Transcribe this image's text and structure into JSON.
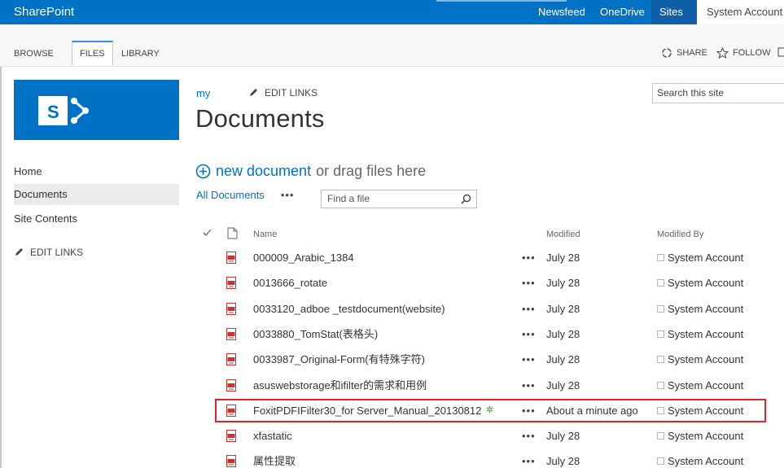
{
  "suitebar": {
    "brand": "SharePoint",
    "links": [
      "Newsfeed",
      "OneDrive",
      "Sites"
    ],
    "account": "System Account"
  },
  "ribbon": {
    "tabs": [
      "BROWSE",
      "FILES",
      "LIBRARY"
    ],
    "active_tab": "FILES",
    "share": "SHARE",
    "follow": "FOLLOW"
  },
  "nav": {
    "items": [
      "Home",
      "Documents",
      "Site Contents"
    ],
    "selected": "Documents",
    "edit_links": "EDIT LINKS"
  },
  "header": {
    "breadcrumb": "my",
    "edit_links": "EDIT LINKS",
    "title": "Documents",
    "search_placeholder": "Search this site"
  },
  "library": {
    "new_document": "new document",
    "drag_text": "or drag files here",
    "view": "All Documents",
    "more": "•••",
    "find_placeholder": "Find a file",
    "columns": {
      "name": "Name",
      "modified": "Modified",
      "modified_by": "Modified By"
    },
    "files": [
      {
        "name": "000009_Arabic_1384",
        "modified": "July 28",
        "modified_by": "System Account"
      },
      {
        "name": "0013666_rotate",
        "modified": "July 28",
        "modified_by": "System Account"
      },
      {
        "name": "0033120_adboe _testdocument(website)",
        "modified": "July 28",
        "modified_by": "System Account"
      },
      {
        "name": "0033880_TomStat(表格头)",
        "modified": "July 28",
        "modified_by": "System Account"
      },
      {
        "name": "0033987_Original-Form(有特殊字符)",
        "modified": "July 28",
        "modified_by": "System Account"
      },
      {
        "name": "asuswebstorage和ifilter的需求和用例",
        "modified": "July 28",
        "modified_by": "System Account"
      },
      {
        "name": "FoxitPDFIFilter30_for Server_Manual_20130812",
        "modified": "About a minute ago",
        "modified_by": "System Account",
        "is_new": true
      },
      {
        "name": "xfastatic",
        "modified": "July 28",
        "modified_by": "System Account"
      },
      {
        "name": "属性提取",
        "modified": "July 28",
        "modified_by": "System Account"
      }
    ],
    "row_ellipsis": "•••",
    "new_marker": "✲"
  },
  "colors": {
    "brand_blue": "#0072c6",
    "highlight_red": "#e0232e",
    "pdf_red": "#c8332b"
  },
  "icons": [
    "share-icon",
    "star-icon",
    "pencil-icon",
    "plus-circle-icon",
    "search-icon",
    "checkmark-icon",
    "document-icon",
    "pdf-icon"
  ]
}
